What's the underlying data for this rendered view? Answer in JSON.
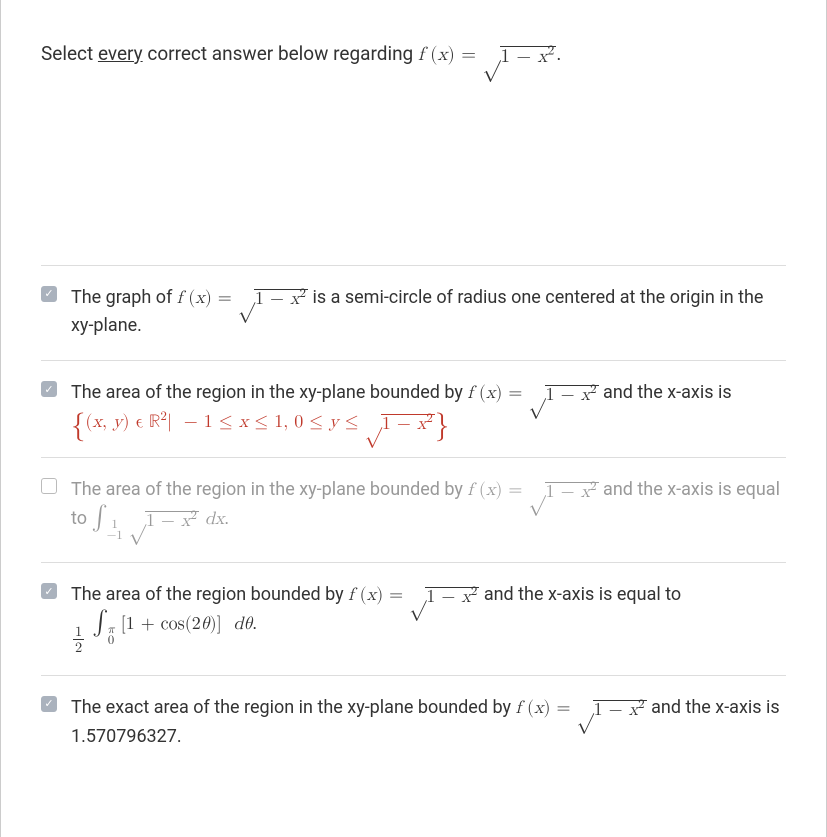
{
  "prompt": {
    "before": "Select ",
    "underline": "every",
    "after": " correct answer below regarding "
  },
  "answers": [
    {
      "checked": true,
      "disabled": false,
      "t1": "The graph of ",
      "t2": " is a semi-circle of radius one centered at the origin in the xy-plane."
    },
    {
      "checked": true,
      "disabled": false,
      "t1": "The area of the region in the xy-plane bounded by ",
      "t2": " and the x-axis is "
    },
    {
      "checked": false,
      "disabled": true,
      "t1": "The area of the region in the xy-plane bounded by ",
      "t2": " and the x-axis is equal to "
    },
    {
      "checked": true,
      "disabled": false,
      "t1": "The area of the region bounded by ",
      "t2": " and the x-axis is equal to "
    },
    {
      "checked": true,
      "disabled": false,
      "t1": "The exact area of the region in the xy-plane bounded by ",
      "t2": " and the x-axis is 1.570796327."
    }
  ]
}
